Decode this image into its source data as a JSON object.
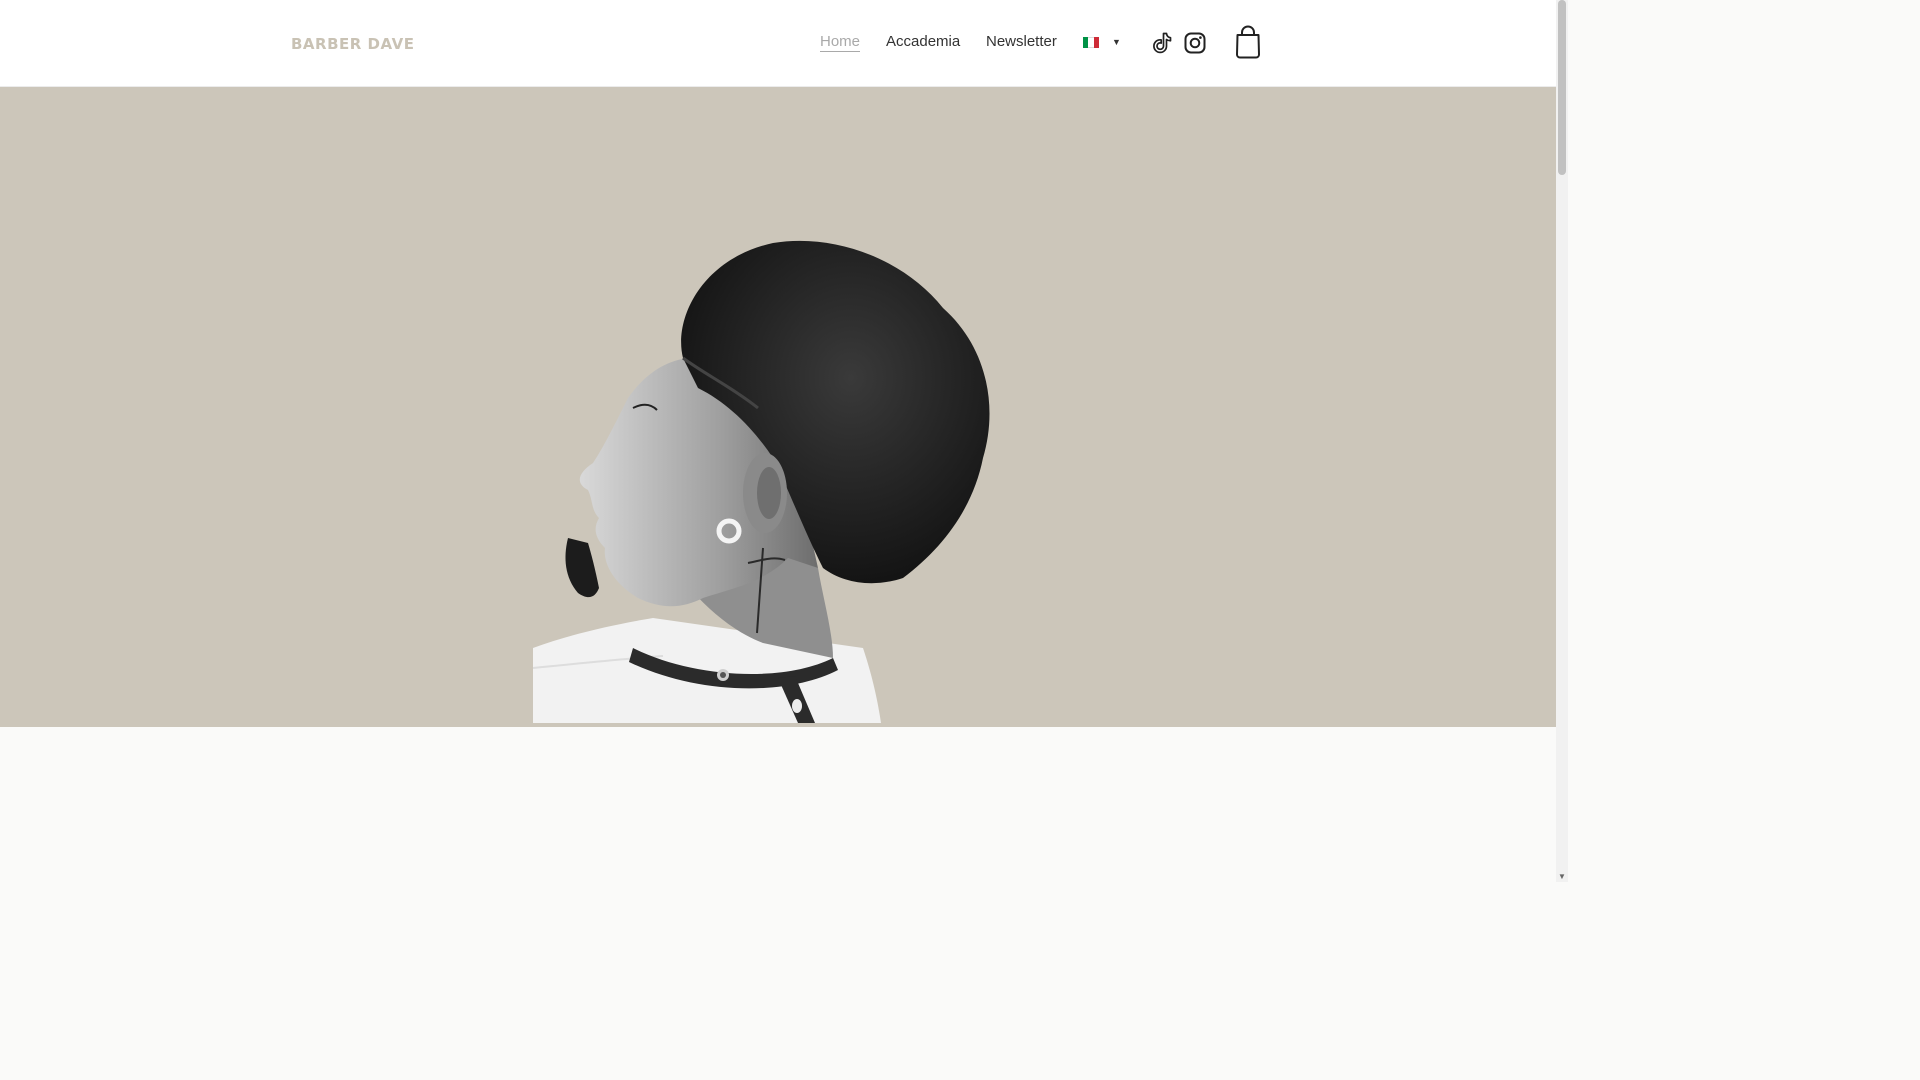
{
  "brand": {
    "logo_text": "BARBER DAVE",
    "logo_color": "#c9c2b4"
  },
  "nav": {
    "items": [
      {
        "label": "Home",
        "active": true
      },
      {
        "label": "Accademia",
        "active": false
      },
      {
        "label": "Newsletter",
        "active": false
      }
    ]
  },
  "language": {
    "flag": "italy-flag",
    "colors": [
      "#009246",
      "#ffffff",
      "#ce2b37"
    ],
    "caret": "▼"
  },
  "social": [
    {
      "icon": "tiktok-icon"
    },
    {
      "icon": "instagram-icon"
    }
  ],
  "cart": {
    "icon": "shopping-bag-icon"
  },
  "hero": {
    "background": "#ccc6ba",
    "image": "barber-profile-portrait"
  },
  "scrollbar": {
    "down_arrow": "▼"
  }
}
